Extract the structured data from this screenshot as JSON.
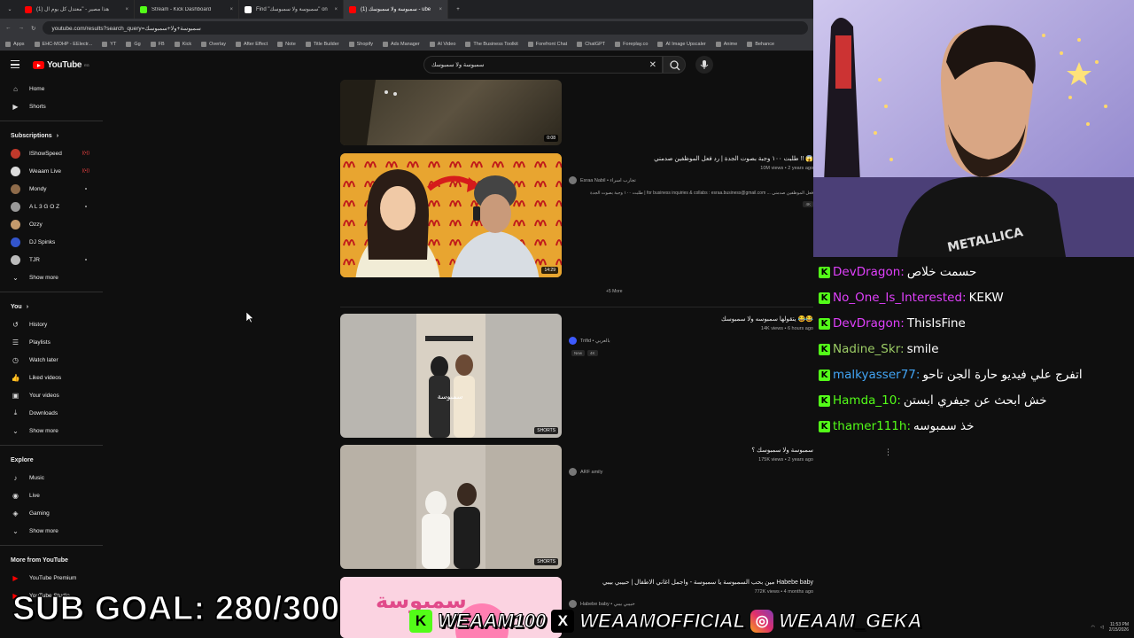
{
  "browser": {
    "tabs": [
      {
        "title": "(1) هذا مصير - \"معتدل كل يوم ال",
        "color": "#ff0000",
        "active": false
      },
      {
        "title": "Stream - Kick Dashboard",
        "color": "#53fc18",
        "active": false
      },
      {
        "title": "Find \"سمبوسة ولا سمبوسك\" on",
        "color": "#ffffff",
        "active": false
      },
      {
        "title": "(1) سمبوسة ولا سمبوسك - ube",
        "color": "#ff0000",
        "active": true
      }
    ],
    "new_tab": "+",
    "url": "youtube.com/results?search_query=سمبوسة+ولا+سمبوسك",
    "bookmarks": [
      "Apps",
      "EHC-MOHP - EElectr...",
      "YT",
      "Gg",
      "FB",
      "Kick",
      "Overlay",
      "After Effect",
      "Note",
      "Title Builder",
      "Shopify",
      "Ads Manager",
      "AI Video",
      "The Business Toolkit",
      "Forefront Chat",
      "ChatGPT",
      "Foreplay.co",
      "AI Image Upscaler",
      "Anime",
      "Behance"
    ]
  },
  "youtube": {
    "logo_text": "YouTube",
    "logo_sup": "EG",
    "search_query": "سمبوسة ولا سمبوسك",
    "sidebar": {
      "main": [
        {
          "label": "Home",
          "icon": "home-icon"
        },
        {
          "label": "Shorts",
          "icon": "shorts-icon"
        }
      ],
      "subscriptions_title": "Subscriptions",
      "subscriptions": [
        {
          "label": "IShowSpeed",
          "color": "#c0392b",
          "status": "live"
        },
        {
          "label": "Weaam Live",
          "color": "#dddddd",
          "status": "live"
        },
        {
          "label": "Mondy",
          "color": "#8e6b4a",
          "status": "dot"
        },
        {
          "label": "A L 3 G O Z",
          "color": "#999999",
          "status": "dot"
        },
        {
          "label": "Ozzy",
          "color": "#c49a6c",
          "status": ""
        },
        {
          "label": "DJ Spinks",
          "color": "#3355cc",
          "status": ""
        },
        {
          "label": "TJR",
          "color": "#bbbbbb",
          "status": "dot"
        }
      ],
      "show_more": "Show more",
      "you_title": "You",
      "you": [
        {
          "label": "History",
          "icon": "history-icon"
        },
        {
          "label": "Playlists",
          "icon": "playlists-icon"
        },
        {
          "label": "Watch later",
          "icon": "watch-later-icon"
        },
        {
          "label": "Liked videos",
          "icon": "liked-icon"
        },
        {
          "label": "Your videos",
          "icon": "your-videos-icon"
        },
        {
          "label": "Downloads",
          "icon": "downloads-icon"
        }
      ],
      "explore_title": "Explore",
      "explore": [
        {
          "label": "Music",
          "icon": "music-icon"
        },
        {
          "label": "Live",
          "icon": "live-icon"
        },
        {
          "label": "Gaming",
          "icon": "gaming-icon"
        }
      ],
      "more_title": "More from YouTube",
      "more": [
        {
          "label": "YouTube Premium"
        },
        {
          "label": "YouTube Studio"
        }
      ]
    },
    "results": {
      "first_duration": "0:08",
      "video1": {
        "title": "😱 !! طلبت ١٠٠ وجبة بصوت الجدة | رد فعل الموظفين صدمني",
        "meta": "10M views • 2 years ago",
        "channel": "Esraa Nabil • تجارب اسراء",
        "desc": "فعل الموظفين صدمني ... for business inquiries & collabs : esraa.business@gmail.com | طلبت ١٠٠ وجبة بصوت الجدة",
        "badge": "4K",
        "duration": "14:29"
      },
      "more_label": "+5 More",
      "short1": {
        "title": "😂😂 يتقولها سمبوسه ولا سمبوسك",
        "meta": "14K views • 6 hours ago",
        "channel": "Trifid • بالعربي",
        "badges": [
          "New",
          "4K"
        ],
        "badge_label": "SHORTS"
      },
      "short2": {
        "title": "سمبوسة ولا سمبوسك ؟",
        "meta": "175K views • 2 years ago",
        "channel": "ARF amily",
        "badge_label": "SHORTS"
      },
      "video3": {
        "title": "Habebe baby مين بحب السمبوسة يا سمبوسة - واجمل اغاني الاطفال | حبيبي بيبي",
        "meta": "772K views • 4 months ago",
        "channel": "Habebe baby • حبيبي بيبي"
      }
    }
  },
  "chat": {
    "messages": [
      {
        "user": "DevDragon:",
        "color": "#e040fb",
        "text": "حسمت خلاص"
      },
      {
        "user": "No_One_Is_Interested:",
        "color": "#e040fb",
        "text": "KEKW"
      },
      {
        "user": "DevDragon:",
        "color": "#e040fb",
        "text": "ThisIsFine"
      },
      {
        "user": "Nadine_Skr:",
        "color": "#9ccc65",
        "text": "smile"
      },
      {
        "user": "malkyasser77:",
        "color": "#42a5f5",
        "text": "اتفرج علي فيديو حارة الجن تاحو"
      },
      {
        "user": "Hamda_10:",
        "color": "#53fc18",
        "text": "خش ابحث عن جيفري ابستن"
      },
      {
        "user": "thamer111h:",
        "color": "#53fc18",
        "text": "خذ سمبوسه"
      }
    ]
  },
  "overlay": {
    "sub_goal": "SUB GOAL: 280/300",
    "kick": "WEAAM100",
    "x": "WEAAMOFFICIAL",
    "instagram": "WEAAM_GEKA"
  },
  "clock": {
    "time": "11:53 PM",
    "date": "2/15/2026"
  }
}
